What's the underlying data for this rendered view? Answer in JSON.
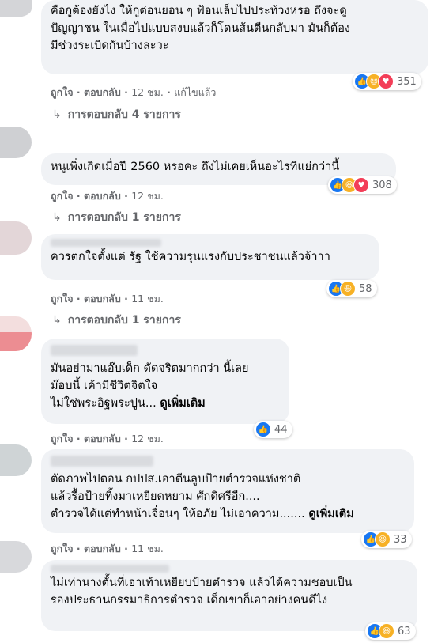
{
  "actions": {
    "like": "ถูกใจ",
    "reply": "ตอบกลับ",
    "sep": " · ",
    "edited": "แก้ไขแล้ว"
  },
  "more_label": "ดูเพิ่มเติม",
  "reaction_icons": {
    "like": "like-icon",
    "haha": "haha-icon",
    "love": "love-icon"
  },
  "colors": {
    "bubble": "#f0f2f5",
    "like": "#1877f2",
    "haha": "#f7b125",
    "love": "#f33e58",
    "meta": "#65676b"
  },
  "comments": [
    {
      "text": "คือกูต้องยังไง ให้กูต่อนยอน ๆ ฟ้อนเล็บไปประท้วงหรอ ถึงจะดู\nปัญญาชน ในเมื่อไปแบบสงบแล้วก็โดนส้นตีนกลับมา มันก็ต้อง\nมีช่วงระเบิดกันบ้างละวะ",
      "time": "12 ชม.",
      "edited": true,
      "reaction_count": "351",
      "reactions": [
        "like",
        "haha",
        "love"
      ],
      "replies": "การตอบกลับ 4 รายการ"
    },
    {
      "text": "หนูเพิ่งเกิดเมื่อปี 2560 หรอคะ ถึงไม่เคยเห็นอะไรที่แย่กว่านี้",
      "time": "12 ชม.",
      "reaction_count": "308",
      "reactions": [
        "like",
        "haha",
        "love"
      ],
      "replies": "การตอบกลับ 1 รายการ"
    },
    {
      "text": "ควรตกใจตั้งแต่ รัฐ ใช้ความรุนแรงกับประชาชนแล้วจ้าาา",
      "time": "11 ชม.",
      "reaction_count": "58",
      "reactions": [
        "like",
        "haha"
      ],
      "replies": "การตอบกลับ 1 รายการ"
    },
    {
      "text": "มันอย่ามาแอ๊บเด็ก ดัดจริตมากกว่า นี้เลย\nม๊อบนี้ เค้ามีชีวิตจิตใจ\nไม่ใช่พระอิฐพระปูน...",
      "time": "12 ชม.",
      "reaction_count": "44",
      "reactions": [
        "like"
      ],
      "more": true
    },
    {
      "text": "ตัดภาพไปตอน กปปส.เอาตีนลูบป้ายตำรวจแห่งชาติ\nแล้วรื้อป้ายทิ้งมาเหยียดหยาม ศักดิศรีอีก....\nตำรวจได้แต่ทำหน้าเจื่อนๆ ให้อภัย ไม่เอาความ.......",
      "time": "11 ชม.",
      "reaction_count": "33",
      "reactions": [
        "like",
        "haha"
      ],
      "more": true
    },
    {
      "text": "ไม่เท่านางตั้นที่เอาเท้าเหยียบป้ายตำรวจ แล้วได้ความชอบเป็น\nรองประธานกรรมาธิการตำรวจ เด็กเขาก็เอาอย่างคนดีไง",
      "reaction_count": "63",
      "reactions": [
        "like",
        "haha"
      ]
    }
  ]
}
